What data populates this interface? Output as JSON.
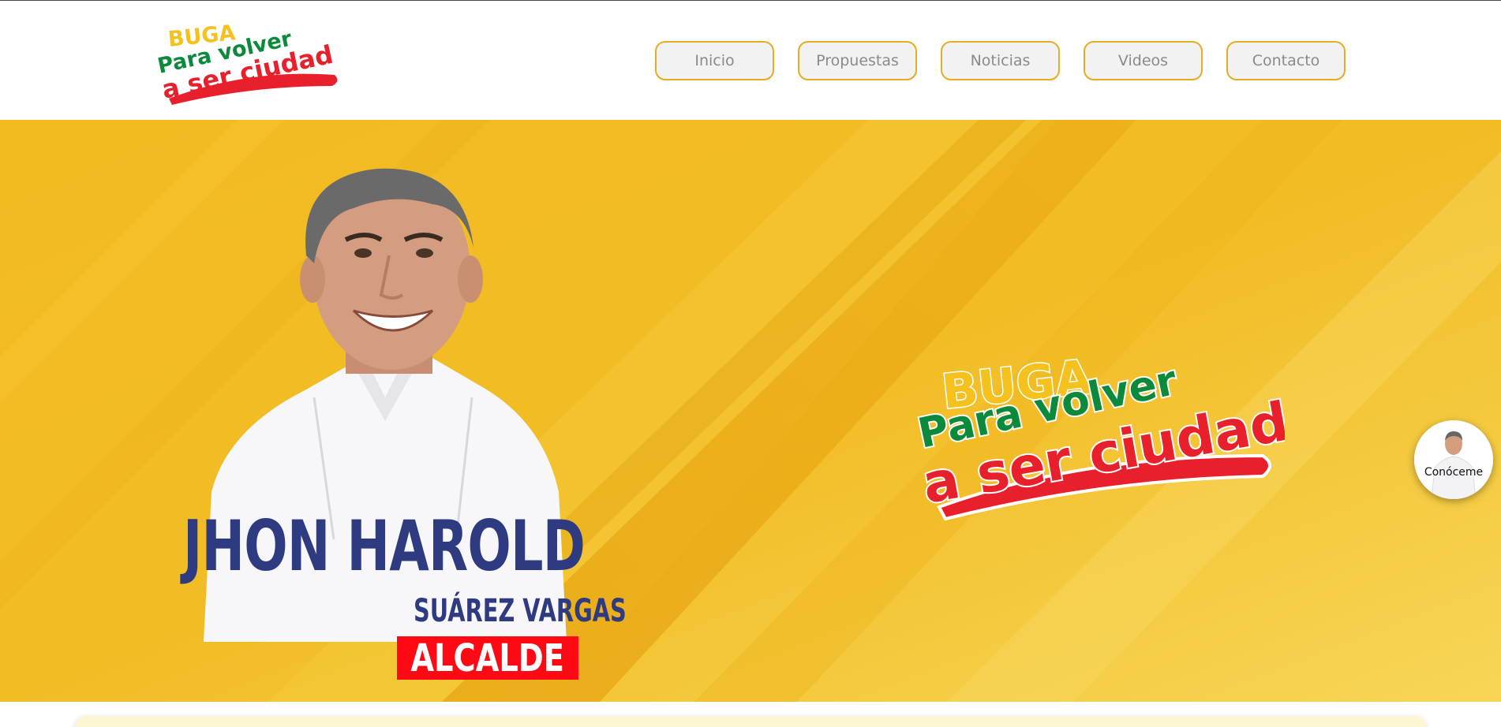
{
  "brand": {
    "line1": "BUGA",
    "line2": "Para volver",
    "line3": "a ser ciudad",
    "colors": {
      "yellow": "#f5c11c",
      "green": "#0b8a3b",
      "red": "#e8202b"
    }
  },
  "nav": {
    "items": [
      {
        "label": "Inicio"
      },
      {
        "label": "Propuestas"
      },
      {
        "label": "Noticias"
      },
      {
        "label": "Videos"
      },
      {
        "label": "Contacto"
      }
    ],
    "border_color": "#e4ad22"
  },
  "hero": {
    "name_first": "JHON HAROLD",
    "name_last": "SUÁREZ VARGAS",
    "role": "ALCALDE",
    "background_color": "#f3bf25",
    "name_color": "#2e3b80",
    "role_color": "#ff0a14"
  },
  "floating": {
    "label": "Conóceme"
  }
}
